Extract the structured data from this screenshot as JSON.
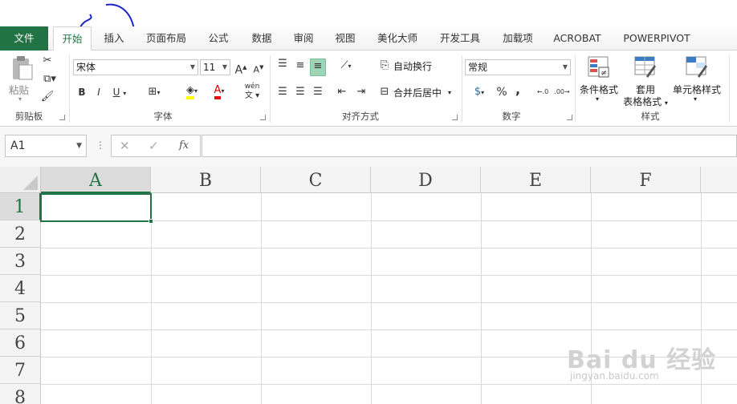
{
  "tabs": [
    {
      "label": "文件"
    },
    {
      "label": "开始"
    },
    {
      "label": "插入"
    },
    {
      "label": "页面布局"
    },
    {
      "label": "公式"
    },
    {
      "label": "数据"
    },
    {
      "label": "审阅"
    },
    {
      "label": "视图"
    },
    {
      "label": "美化大师"
    },
    {
      "label": "开发工具"
    },
    {
      "label": "加载项"
    },
    {
      "label": "ACROBAT"
    },
    {
      "label": "POWERPIVOT"
    }
  ],
  "active_tab": "开始",
  "ribbon": {
    "clipboard": {
      "paste_label": "粘贴",
      "group_label": "剪贴板"
    },
    "font": {
      "font_name": "宋体",
      "font_size": "11",
      "group_label": "字体",
      "bold": "B",
      "italic": "I",
      "underline": "U",
      "grow": "A",
      "shrink": "A",
      "font_color_letter": "A",
      "phonetic": "wén"
    },
    "alignment": {
      "wrap_text": "自动换行",
      "merge_center": "合并后居中",
      "group_label": "对齐方式"
    },
    "number": {
      "format": "常规",
      "group_label": "数字",
      "percent": "%",
      "comma": ","
    },
    "styles": {
      "conditional": "条件格式",
      "table_format_1": "套用",
      "table_format_2": "表格格式",
      "cell_styles": "单元格样式",
      "group_label": "样式"
    }
  },
  "formula_bar": {
    "name_box": "A1",
    "fx": "fx",
    "cancel": "✕",
    "enter": "✓",
    "value": ""
  },
  "grid": {
    "columns": [
      "A",
      "B",
      "C",
      "D",
      "E",
      "F"
    ],
    "rows": [
      "1",
      "2",
      "3",
      "4",
      "5",
      "6",
      "7",
      "8"
    ],
    "selected_cell": "A1"
  },
  "watermark": {
    "brand": "Bai du 经验",
    "url": "jingyan.baidu.com"
  },
  "colors": {
    "accent": "#217346",
    "annotation": "#1a23c8"
  }
}
